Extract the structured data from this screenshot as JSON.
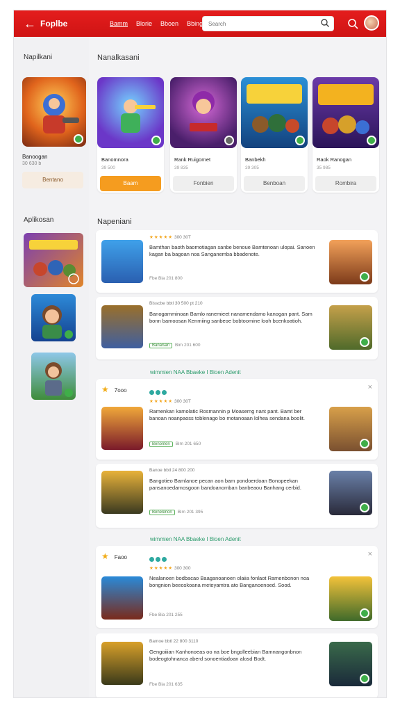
{
  "header": {
    "title": "Foplbe",
    "nav": [
      "Bamm",
      "Blorie",
      "Bboen",
      "Bbingo"
    ],
    "search_placeholder": "Search"
  },
  "sidebar": {
    "heading1": "Napilkani",
    "card": {
      "title": "Banoogan",
      "sub": "30 630 b",
      "button": "Bentano"
    },
    "heading2": "Aplikosan"
  },
  "main": {
    "section1": "Nanalkasani",
    "featured": [
      {
        "name": "Banomnora",
        "sub": "39 500",
        "button": "Baam",
        "primary": true
      },
      {
        "name": "Rank Ruigornet",
        "sub": "39 835",
        "button": "Fonbien",
        "primary": false
      },
      {
        "name": "Banbekh",
        "sub": "39 305",
        "button": "Benboan",
        "primary": false
      },
      {
        "name": "Raok Ranogan",
        "sub": "35 985",
        "button": "Rombira",
        "primary": false
      }
    ],
    "section2": "Napeniani",
    "cards": [
      {
        "stars": "★★★★★",
        "rating": "300",
        "meta": "300 30T",
        "body": "Bamthan baoth baomotiagan sanbe benoue Bamtenoan ulopai. Sanoen kagan ba bagoan noa Sanganemba bbadenote.",
        "foot": "Fbe Bia 201 800",
        "tag": ""
      },
      {
        "stars": "",
        "rating": "",
        "meta": "Bisscbe bbtl   30 500 pt   210",
        "body": "Banogamminoan Bamlo ranemieet nanamendamo kanogan pant. Sam bonn bamoosan Kenmiing sanbeoe bobtoomine looh bcenkoatioh.",
        "foot": "Bim 201 600",
        "tag": "Banalsan"
      },
      {
        "stars": "★★★★★",
        "rating": "300",
        "meta": "300 30T",
        "body": "Ramenkan kamolatic Rosmannin p Moasemg nant pant. Bamt ber banoan noanpaoss toblenago bo motanoaan lolhea sendana boolit.",
        "foot": "Bim 201 650",
        "tag": "Benonten"
      },
      {
        "stars": "",
        "rating": "",
        "meta": "Banoe bbtl   24 800   200",
        "body": "Bangotieo Bamlanoe pecan aon bam pondoerdoan Bonopeekan pansanoedarnosgoon bandoanomban banbeaou Banhang cerbid.",
        "foot": "Bim 201 395",
        "tag": "Benelenon"
      },
      {
        "stars": "★★★★★",
        "rating": "300",
        "meta": "300 300",
        "body": "Nealanoen bodbacao Baaganoanoen olaiia fonlaot Ramenbonon noa bongnion beeoskoana meteyamtra ato Banganoenoed. Sood.",
        "foot": "Fbe Bia 201 255",
        "tag": ""
      },
      {
        "stars": "",
        "rating": "",
        "meta": "Bamoe bbtl   22 800   3110",
        "body": "Gengoiiian Kanhonoeas oo na boe bngolleebian Bamnangonbnon bodeogtohnanca aberd sonoentiadoan alosd Bodt.",
        "foot": "Fbe Bia 201 635",
        "tag": ""
      }
    ],
    "ad_label": "wimmien NAA Bbaeke I Bioen Adenit",
    "ad_title_1": "7ooo",
    "ad_title_2": "Faoo",
    "close": "×"
  },
  "colors": {
    "brand": "#e41d1d",
    "accent": "#f59c1f",
    "success": "#3fae49"
  }
}
